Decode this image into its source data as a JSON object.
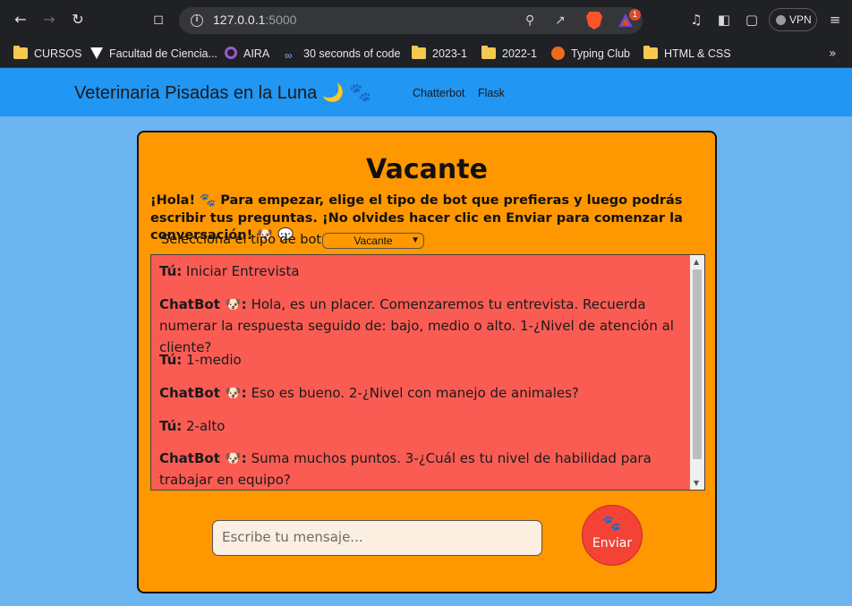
{
  "browser": {
    "url_host": "127.0.0.1",
    "url_port": ":5000",
    "rewards_badge": "1",
    "vpn_label": "VPN",
    "bookmarks": [
      {
        "label": "CURSOS",
        "icon": "folder-icon"
      },
      {
        "label": "Facultad de Ciencia...",
        "icon": "faculty-logo-icon"
      },
      {
        "label": "AIRA",
        "icon": "aira-icon"
      },
      {
        "label": "30 seconds of code",
        "icon": "code-icon"
      },
      {
        "label": "2023-1",
        "icon": "folder-icon"
      },
      {
        "label": "2022-1",
        "icon": "folder-icon"
      },
      {
        "label": "Typing Club",
        "icon": "typing-club-icon"
      },
      {
        "label": "HTML & CSS",
        "icon": "folder-icon"
      }
    ],
    "more_label": "»"
  },
  "navbar": {
    "brand": "Veterinaria Pisadas en la Luna 🌙 🐾",
    "links": [
      "Chatterbot",
      "Flask"
    ]
  },
  "card": {
    "title": "Vacante",
    "intro": "¡Hola! 🐾 Para empezar, elige el tipo de bot que prefieras y luego podrás escribir tus preguntas. ¡No olvides hacer clic en Enviar para comenzar la conversación! 🐶 💬",
    "select_label": "Selecciona el tipo de bot:",
    "select_value": "Vacante",
    "messages": [
      {
        "speaker": "Tú:",
        "text": " Iniciar Entrevista"
      },
      {
        "speaker": "ChatBot 🐶:",
        "text": " Hola, es un placer. Comenzaremos tu entrevista. Recuerda numerar la respuesta seguido de: bajo, medio o alto. 1-¿Nivel de atención al cliente?"
      },
      {
        "speaker": "Tú:",
        "text": " 1-medio"
      },
      {
        "speaker": "ChatBot 🐶:",
        "text": " Eso es bueno. 2-¿Nivel con manejo de animales?"
      },
      {
        "speaker": "Tú:",
        "text": " 2-alto"
      },
      {
        "speaker": "ChatBot 🐶:",
        "text": " Suma muchos puntos. 3-¿Cuál es tu nivel de habilidad para trabajar en equipo?"
      }
    ],
    "input_placeholder": "Escribe tu mensaje...",
    "send_label": "Enviar",
    "send_icon": "🐾"
  },
  "colors": {
    "navbar": "#2196f3",
    "page_bg": "#6cb4f0",
    "card_bg": "#ff9800",
    "chat_bg": "#fa5c54",
    "send_button": "#f44336"
  }
}
